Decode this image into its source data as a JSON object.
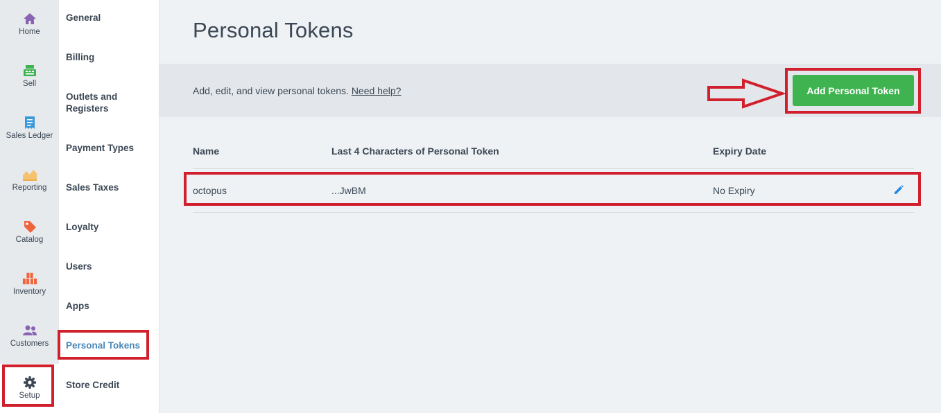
{
  "rail": {
    "items": [
      {
        "label": "Home",
        "icon": "home-icon",
        "color": "#8a63b3"
      },
      {
        "label": "Sell",
        "icon": "register-icon",
        "color": "#3fb34f"
      },
      {
        "label": "Sales Ledger",
        "icon": "receipt-icon",
        "color": "#3a9ad9"
      },
      {
        "label": "Reporting",
        "icon": "chart-icon",
        "color": "#f0ad4e"
      },
      {
        "label": "Catalog",
        "icon": "tag-icon",
        "color": "#f0643c"
      },
      {
        "label": "Inventory",
        "icon": "boxes-icon",
        "color": "#f0643c"
      },
      {
        "label": "Customers",
        "icon": "users-icon",
        "color": "#8a63b3"
      },
      {
        "label": "Setup",
        "icon": "gear-icon",
        "color": "#3b4754"
      }
    ]
  },
  "subnav": {
    "items": [
      {
        "label": "General"
      },
      {
        "label": "Billing"
      },
      {
        "label": "Outlets and Registers"
      },
      {
        "label": "Payment Types"
      },
      {
        "label": "Sales Taxes"
      },
      {
        "label": "Loyalty"
      },
      {
        "label": "Users"
      },
      {
        "label": "Apps"
      },
      {
        "label": "Personal Tokens"
      },
      {
        "label": "Store Credit"
      }
    ],
    "active": "Personal Tokens"
  },
  "main": {
    "title": "Personal Tokens",
    "banner_text": "Add, edit, and view personal tokens.",
    "help_link": "Need help?",
    "add_button": "Add Personal Token"
  },
  "table": {
    "columns": [
      "Name",
      "Last 4 Characters of Personal Token",
      "Expiry Date"
    ],
    "rows": [
      {
        "name": "octopus",
        "last4": "...JwBM",
        "expiry": "No Expiry"
      }
    ]
  },
  "colors": {
    "accent_green": "#3fb34f",
    "annotation_red": "#d1202d",
    "active_link": "#4a88b8",
    "edit_blue": "#1e88e5"
  }
}
